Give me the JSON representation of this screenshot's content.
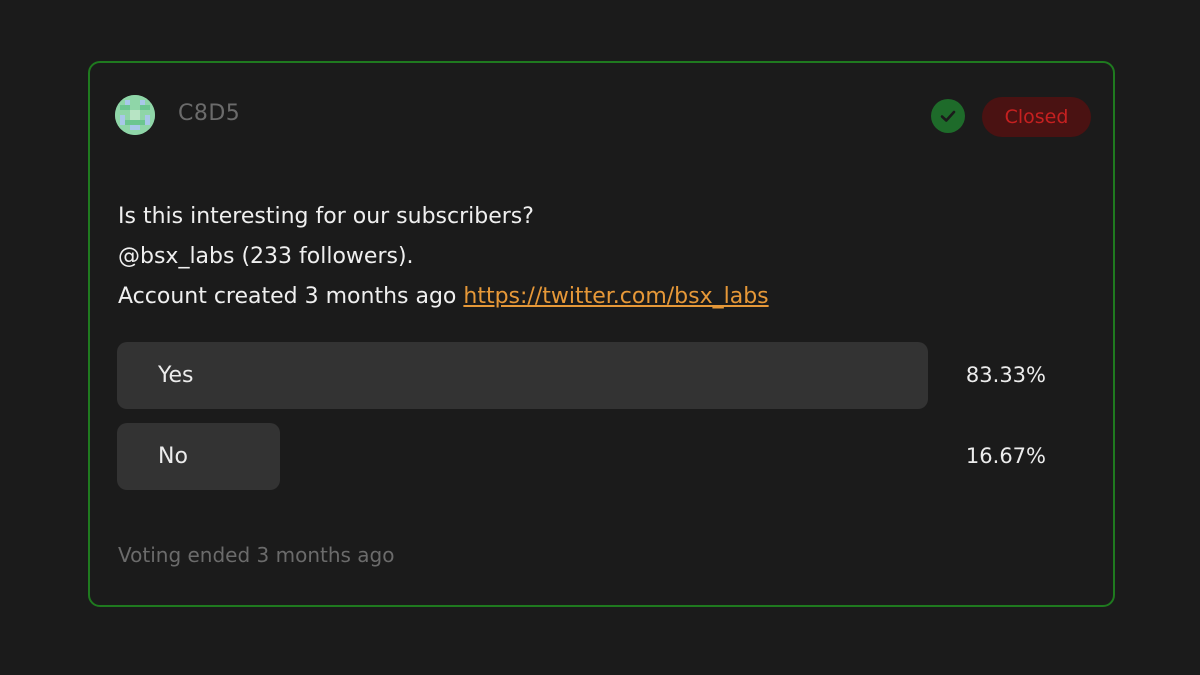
{
  "post": {
    "author": "C8D5",
    "status": "Closed",
    "question_lines": [
      "Is this interesting for our subscribers?",
      "@bsx_labs (233 followers).",
      "Account created 3 months ago"
    ],
    "link_text": "https://twitter.com/bsx_labs"
  },
  "options": [
    {
      "label": "Yes",
      "percent_text": "83.33%",
      "percent": 83.33
    },
    {
      "label": "No",
      "percent_text": "16.67%",
      "percent": 16.67
    }
  ],
  "footer": {
    "text": "Voting ended 3 months ago"
  },
  "colors": {
    "border": "#1f7a1f",
    "status_bg": "#4a1212",
    "status_text": "#c62020",
    "link": "#e69838",
    "check": "#1e6b2a"
  },
  "icons": {
    "avatar": "pixel-avatar",
    "verified": "check-circle-icon"
  }
}
